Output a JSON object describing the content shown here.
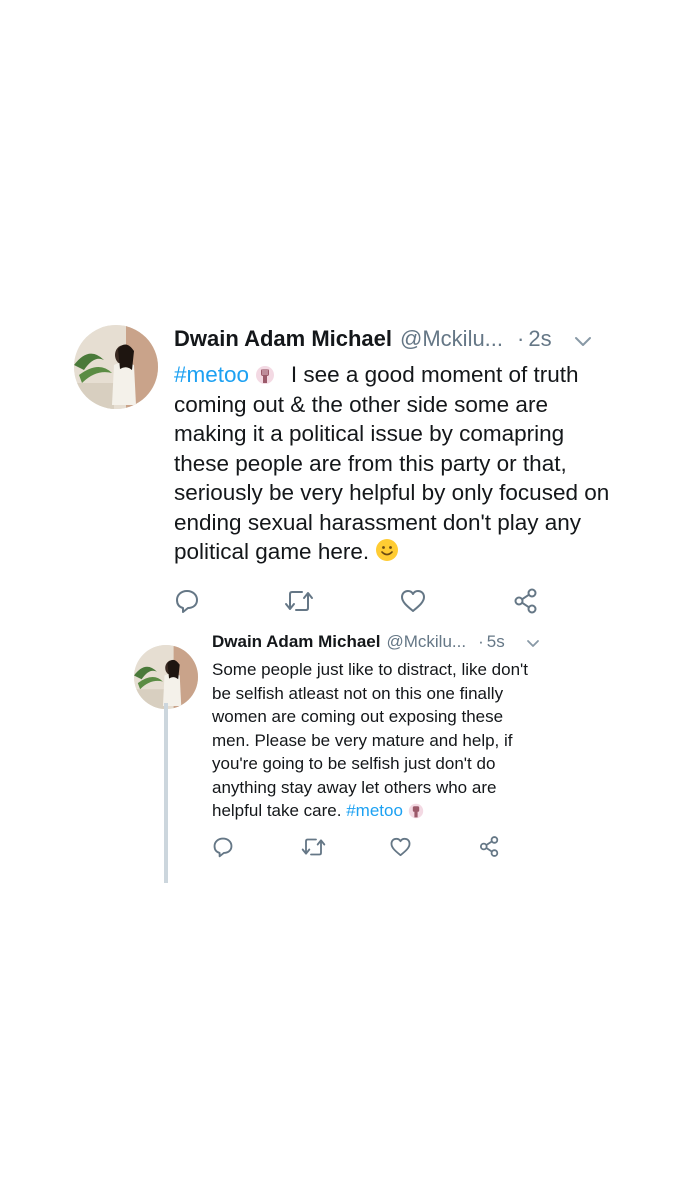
{
  "tweets": [
    {
      "name": "Dwain Adam Michael",
      "handle": "@Mckilu...",
      "separator": "·",
      "time": "2s",
      "hashtag": "#metoo",
      "text": "I see a good moment of truth coming out & the other side some are making it a political issue by comapring these people are from this party or that, seriously be very helpful by only focused on ending sexual harassment don't play any political game here."
    },
    {
      "name": "Dwain Adam Michael",
      "handle": "@Mckilu...",
      "separator": "·",
      "time": "5s",
      "text": "Some people just like to distract, like don't be selfish atleast not on this one finally women are coming out exposing these men. Please be very mature and help, if you're going to be selfish just don't do anything stay away let others who are helpful take care.",
      "hashtag": "#metoo"
    }
  ],
  "icons": {
    "reply": "reply-icon",
    "retweet": "retweet-icon",
    "like": "heart-icon",
    "share": "share-icon",
    "more": "chevron-down-icon",
    "raised_fist": "raised-fist-emoji",
    "smile": "slightly-smiling-face-emoji"
  },
  "colors": {
    "hashtag": "#1da1f2",
    "secondary_text": "#657786",
    "action_icon": "#657786",
    "thread_line": "#ccd6dd"
  }
}
